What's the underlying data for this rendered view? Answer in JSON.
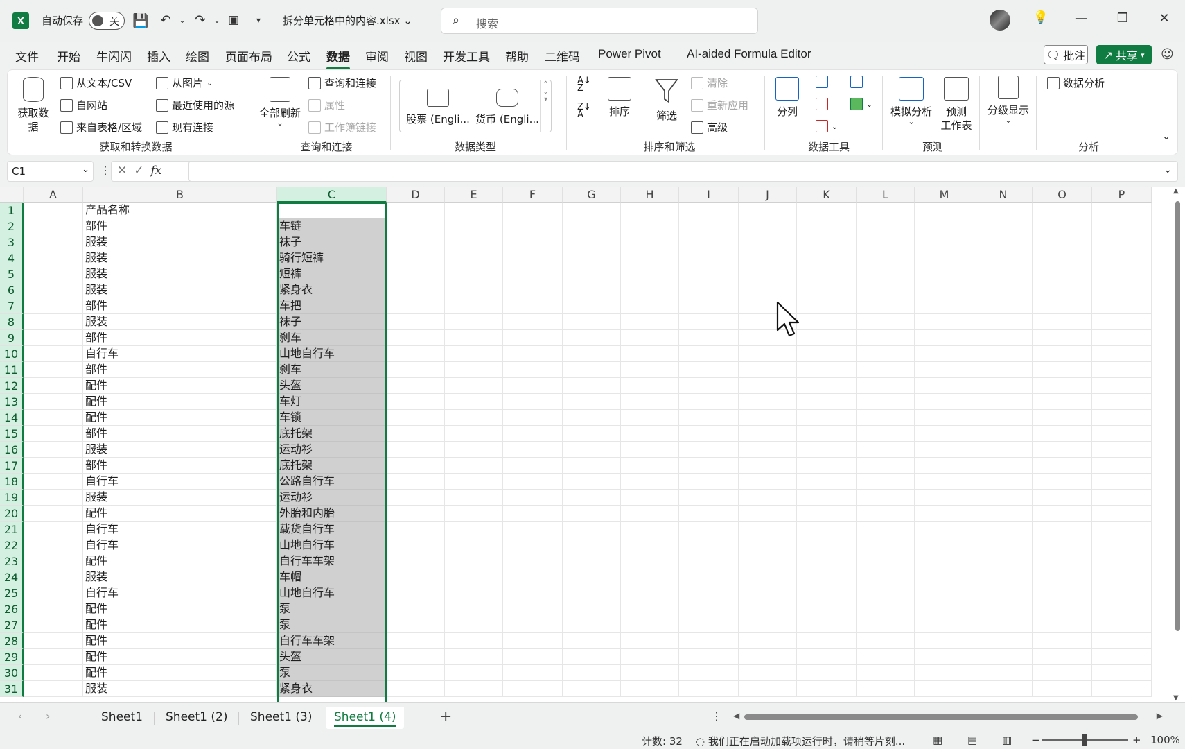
{
  "titlebar": {
    "autosave_label": "自动保存",
    "autosave_state": "关",
    "filename": "拆分单元格中的内容.xlsx",
    "search_placeholder": "搜索"
  },
  "menu": {
    "tabs": [
      "文件",
      "开始",
      "牛闪闪",
      "插入",
      "绘图",
      "页面布局",
      "公式",
      "数据",
      "审阅",
      "视图",
      "开发工具",
      "帮助",
      "二维码",
      "Power Pivot",
      "AI-aided Formula Editor"
    ],
    "active_tab": "数据",
    "comment_label": "批注",
    "share_label": "共享"
  },
  "ribbon": {
    "get_data": "获取数\n据",
    "from_text_csv": "从文本/CSV",
    "from_web": "自网站",
    "from_table": "来自表格/区域",
    "from_picture": "从图片",
    "recent_sources": "最近使用的源",
    "existing_connections": "现有连接",
    "group_get_transform": "获取和转换数据",
    "refresh_all": "全部刷新",
    "queries_connections": "查询和连接",
    "properties": "属性",
    "workbook_links": "工作簿链接",
    "group_queries": "查询和连接",
    "stocks": "股票 (Engli...",
    "currencies": "货币 (Engli...",
    "group_data_types": "数据类型",
    "sort": "排序",
    "filter": "筛选",
    "clear": "清除",
    "reapply": "重新应用",
    "advanced": "高级",
    "group_sort_filter": "排序和筛选",
    "text_to_columns": "分列",
    "group_data_tools": "数据工具",
    "what_if": "模拟分析",
    "forecast_sheet": "预测\n工作表",
    "group_forecast": "预测",
    "outline": "分级显示",
    "data_analysis": "数据分析",
    "group_analysis": "分析"
  },
  "formula_bar": {
    "name_box": "C1",
    "fx_label": "fx",
    "formula": ""
  },
  "grid": {
    "columns": [
      "A",
      "B",
      "C",
      "D",
      "E",
      "F",
      "G",
      "H",
      "I",
      "J",
      "K",
      "L",
      "M",
      "N",
      "O",
      "P"
    ],
    "selected_column": "C",
    "row_numbers": [
      "1",
      "2",
      "3",
      "4",
      "5",
      "6",
      "7",
      "8",
      "9",
      "10",
      "11",
      "12",
      "13",
      "14",
      "15",
      "16",
      "17",
      "18",
      "19",
      "20",
      "21",
      "22",
      "23",
      "24",
      "25",
      "26",
      "27",
      "28",
      "29",
      "30",
      "31"
    ],
    "col_b": [
      "产品名称",
      "部件",
      "服装",
      "服装",
      "服装",
      "服装",
      "部件",
      "服装",
      "部件",
      "自行车",
      "部件",
      "配件",
      "配件",
      "配件",
      "部件",
      "服装",
      "部件",
      "自行车",
      "服装",
      "配件",
      "自行车",
      "自行车",
      "配件",
      "服装",
      "自行车",
      "配件",
      "配件",
      "配件",
      "配件",
      "配件",
      "服装"
    ],
    "col_c": [
      "",
      "车链",
      "袜子",
      "骑行短裤",
      "短裤",
      "紧身衣",
      "车把",
      "袜子",
      "刹车",
      "山地自行车",
      "刹车",
      "头盔",
      "车灯",
      "车锁",
      "底托架",
      "运动衫",
      "底托架",
      "公路自行车",
      "运动衫",
      "外胎和内胎",
      "载货自行车",
      "山地自行车",
      "自行车车架",
      "车帽",
      "山地自行车",
      "泵",
      "泵",
      "自行车车架",
      "头盔",
      "泵",
      "紧身衣"
    ]
  },
  "sheets": {
    "tabs": [
      "Sheet1",
      "Sheet1 (2)",
      "Sheet1 (3)",
      "Sheet1 (4)"
    ],
    "active": "Sheet1 (4)"
  },
  "status": {
    "count": "计数: 32",
    "message": "我们正在启动加载项运行时，请稍等片刻...",
    "zoom": "100%"
  }
}
